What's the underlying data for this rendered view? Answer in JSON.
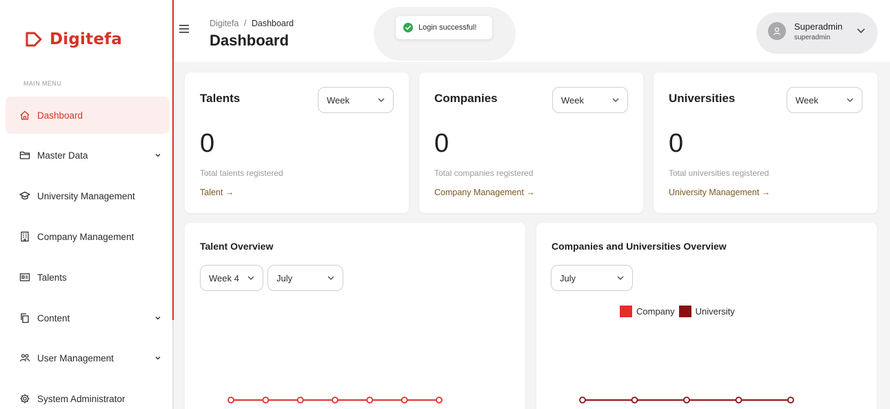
{
  "brand": {
    "name": "Digitefa",
    "color": "#d93025"
  },
  "sidebar": {
    "section_label": "MAIN MENU",
    "items": [
      {
        "label": "Dashboard",
        "icon": "home-icon",
        "active": true,
        "has_submenu": false
      },
      {
        "label": "Master Data",
        "icon": "folder-icon",
        "active": false,
        "has_submenu": true
      },
      {
        "label": "University Management",
        "icon": "graduation-cap-icon",
        "active": false,
        "has_submenu": false
      },
      {
        "label": "Company Management",
        "icon": "building-icon",
        "active": false,
        "has_submenu": false
      },
      {
        "label": "Talents",
        "icon": "id-card-icon",
        "active": false,
        "has_submenu": false
      },
      {
        "label": "Content",
        "icon": "copy-icon",
        "active": false,
        "has_submenu": true
      },
      {
        "label": "User Management",
        "icon": "users-icon",
        "active": false,
        "has_submenu": true
      },
      {
        "label": "System Administrator",
        "icon": "gear-icon",
        "active": false,
        "has_submenu": false
      }
    ]
  },
  "header": {
    "breadcrumb": {
      "root": "Digitefa",
      "separator": "/",
      "current": "Dashboard"
    },
    "title": "Dashboard",
    "toast": "Login successful!",
    "user": {
      "name": "Superadmin",
      "role": "superadmin"
    }
  },
  "stats": [
    {
      "title": "Talents",
      "period": "Week",
      "value": "0",
      "description": "Total talents registered",
      "link": "Talent →"
    },
    {
      "title": "Companies",
      "period": "Week",
      "value": "0",
      "description": "Total companies registered",
      "link": "Company Management →"
    },
    {
      "title": "Universities",
      "period": "Week",
      "value": "0",
      "description": "Total universities registered",
      "link": "University Management →"
    }
  ],
  "talent_overview": {
    "title": "Talent Overview",
    "week": "Week 4",
    "month": "July"
  },
  "cu_overview": {
    "title": "Companies and Universities Overview",
    "month": "July"
  },
  "chart_data": [
    {
      "type": "line",
      "title": "Talent Overview",
      "series": [
        {
          "values": [
            0,
            0,
            0,
            0,
            0,
            0,
            0
          ],
          "color": "#e0302a"
        }
      ]
    },
    {
      "type": "line",
      "title": "Companies and Universities Overview",
      "legend": [
        "Company",
        "University"
      ],
      "legend_position": "top",
      "series": [
        {
          "name": "Company",
          "values": [
            0,
            0,
            0,
            0,
            0
          ],
          "color": "#e0302a"
        },
        {
          "name": "University",
          "values": [
            0,
            0,
            0,
            0,
            0
          ],
          "color": "#8b1111"
        }
      ]
    }
  ]
}
